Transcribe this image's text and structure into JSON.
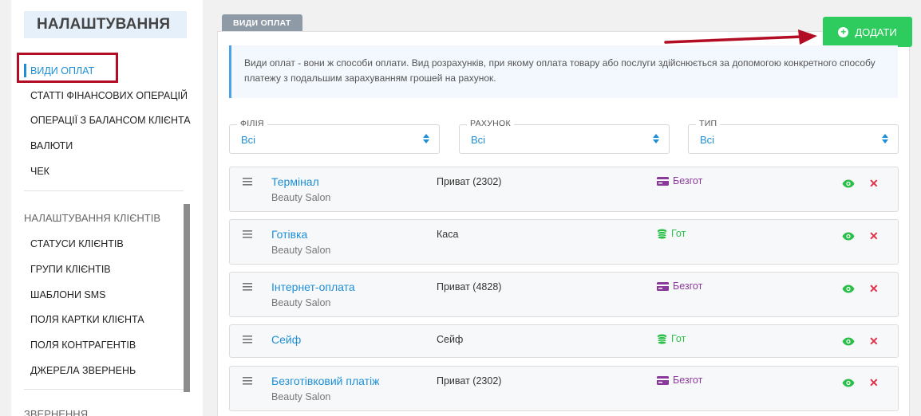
{
  "sidebar": {
    "title": "НАЛАШТУВАННЯ",
    "items": [
      {
        "label": "ВИДИ ОПЛАТ",
        "active": true
      },
      {
        "label": "СТАТТІ ФІНАНСОВИХ ОПЕРАЦІЙ"
      },
      {
        "label": "ОПЕРАЦІЇ З БАЛАНСОМ КЛІЄНТА"
      },
      {
        "label": "ВАЛЮТИ"
      },
      {
        "label": "ЧЕК"
      }
    ],
    "section2": {
      "title": "НАЛАШТУВАННЯ КЛІЄНТІВ",
      "items": [
        {
          "label": "СТАТУСИ КЛІЄНТІВ"
        },
        {
          "label": "ГРУПИ КЛІЄНТІВ"
        },
        {
          "label": "ШАБЛОНИ SMS"
        },
        {
          "label": "ПОЛЯ КАРТКИ КЛІЄНТА"
        },
        {
          "label": "ПОЛЯ КОНТРАГЕНТІВ"
        },
        {
          "label": "ДЖЕРЕЛА ЗВЕРНЕНЬ"
        }
      ]
    },
    "section3": {
      "title": "ЗВЕРНЕННЯ"
    }
  },
  "main": {
    "tab_label": "ВИДИ ОПЛАТ",
    "add_button": "ДОДАТИ",
    "info_text": "Види оплат - вони ж способи оплати. Вид розрахунків, при якому оплата товару або послуги здійснюється за допомогою конкретного способу платежу з подальшим зарахуванням грошей на рахунок.",
    "filters": [
      {
        "label": "ФІЛІЯ",
        "value": "Всі"
      },
      {
        "label": "РАХУНОК",
        "value": "Всі"
      },
      {
        "label": "ТИП",
        "value": "Всі"
      }
    ],
    "rows": [
      {
        "name": "Термінал",
        "branch": "Beauty Salon",
        "account": "Приват (2302)",
        "type": "Безгот",
        "type_kind": "cashless"
      },
      {
        "name": "Готівка",
        "branch": "Beauty Salon",
        "account": "Каса",
        "type": "Гот",
        "type_kind": "cash"
      },
      {
        "name": "Інтернет-оплата",
        "branch": "Beauty Salon",
        "account": "Приват (4828)",
        "type": "Безгот",
        "type_kind": "cashless"
      },
      {
        "name": "Сейф",
        "branch": "",
        "account": "Сейф",
        "type": "Гот",
        "type_kind": "cash"
      },
      {
        "name": "Безготівковий платіж",
        "branch": "Beauty Salon",
        "account": "Приват (2302)",
        "type": "Безгот",
        "type_kind": "cashless"
      }
    ]
  },
  "colors": {
    "accent": "#1e8fd6",
    "add_button": "#2ecc5e",
    "cashless": "#8a3a9a",
    "cash": "#2bbf4a",
    "delete": "#e0304a",
    "highlight": "#b30d25"
  },
  "icons": {
    "add": "plus-circle-icon",
    "drag": "drag-handle-icon",
    "cashless": "credit-card-icon",
    "cash": "coins-icon",
    "view": "eye-icon",
    "delete": "close-icon"
  }
}
